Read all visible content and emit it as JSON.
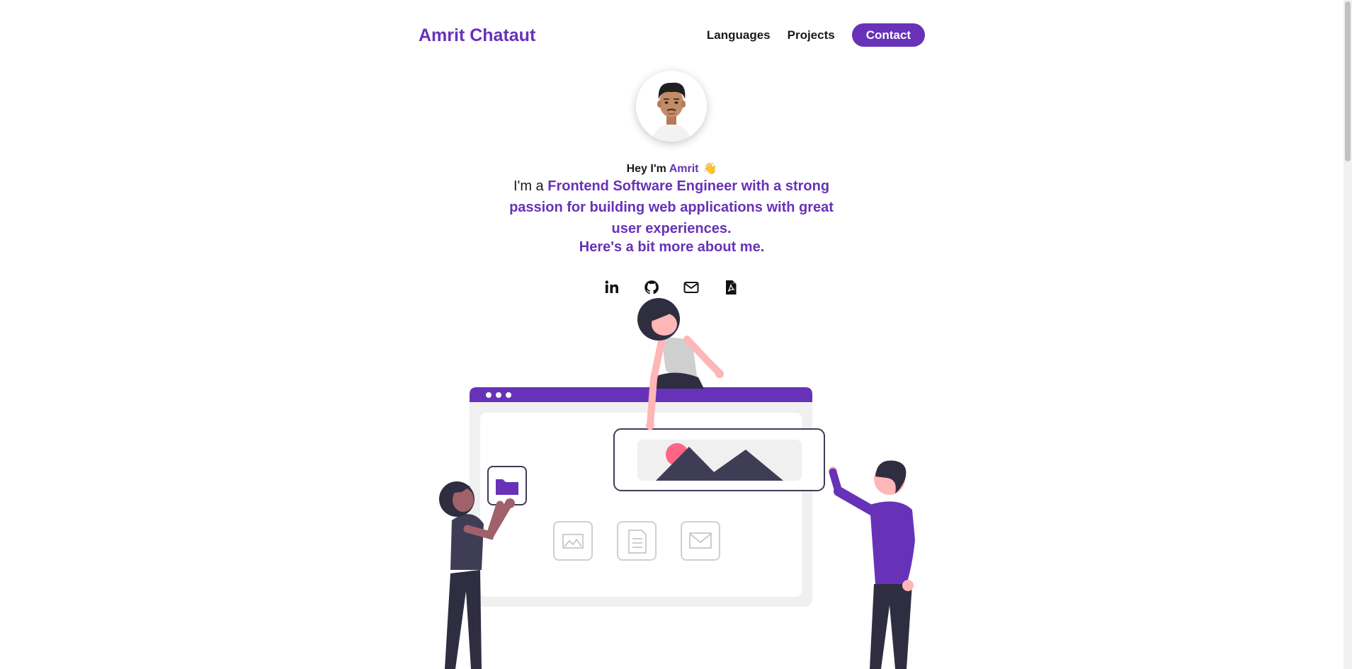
{
  "header": {
    "brand": "Amrit Chataut",
    "nav": [
      {
        "label": "Languages"
      },
      {
        "label": "Projects"
      },
      {
        "label": "Contact"
      }
    ]
  },
  "intro": {
    "greeting_prefix": "Hey I'm ",
    "greeting_name": "Amrit",
    "wave": "👋",
    "tagline_prefix": "I'm a ",
    "tagline_highlight": "Frontend Software Engineer with a strong passion for building web applications with great user experiences.",
    "more_link": "Here's a bit more about me."
  },
  "socials": [
    {
      "icon": "linkedin-icon"
    },
    {
      "icon": "github-icon"
    },
    {
      "icon": "mail-icon"
    },
    {
      "icon": "pdf-resume-icon"
    }
  ],
  "colors": {
    "accent": "#6732b8",
    "text": "#1a1a1a",
    "dark_figure": "#2f2e41",
    "skin": "#ffb6b6",
    "sun": "#ff6584"
  }
}
